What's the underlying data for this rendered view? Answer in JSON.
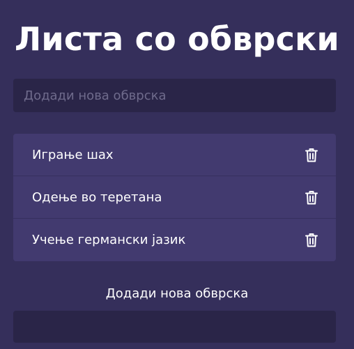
{
  "header": {
    "title": "Листа со обврски"
  },
  "search": {
    "placeholder": "Додади нова обврска",
    "value": ""
  },
  "todos": [
    {
      "text": "Играње шах",
      "action_icon": "trash-icon"
    },
    {
      "text": "Одење во теретана",
      "action_icon": "trash-icon"
    },
    {
      "text": "Учење германски јазик",
      "action_icon": "trash-icon"
    }
  ],
  "add_form": {
    "label": "Додади нова обврска",
    "value": ""
  },
  "colors": {
    "background": "#352f5b",
    "input_background": "#2a2548",
    "list_background": "#423a6f",
    "divider": "#36305e",
    "text": "#ffffff",
    "placeholder": "#6f6b8c"
  }
}
